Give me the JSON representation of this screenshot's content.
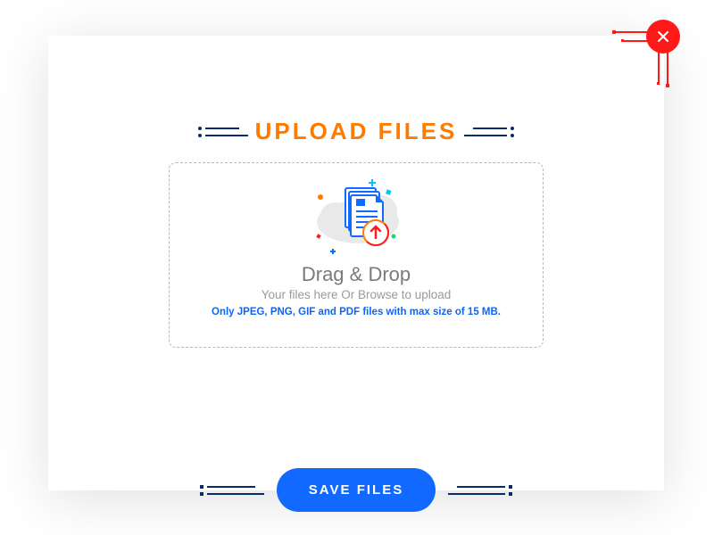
{
  "modal": {
    "title": "UPLOAD FILES",
    "dropzone": {
      "heading": "Drag & Drop",
      "subheading": "Your files here Or Browse to upload",
      "hint": "Only JPEG, PNG, GIF and PDF files with max size of 15 MB."
    },
    "save_button_label": "SAVE FILES",
    "colors": {
      "accent_orange": "#ff7a00",
      "accent_blue": "#1169ff",
      "accent_red": "#ff1a1a"
    }
  }
}
